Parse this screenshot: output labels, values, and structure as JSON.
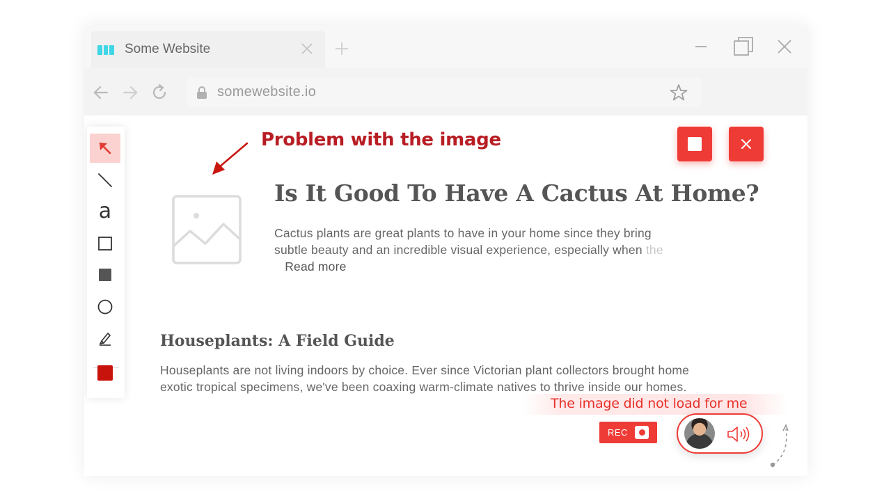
{
  "browser": {
    "tab_title": "Some Website",
    "url": "somewebsite.io"
  },
  "annotation": {
    "title": "Problem with the image",
    "comment": "The image did not load for me"
  },
  "article": {
    "title": "Is It Good To Have A Cactus At Home?",
    "body": "Cactus plants are great plants to have in your home since they bring subtle beauty and an incredible visual experience, especially when ",
    "body_faded": "the",
    "read_more": "Read more"
  },
  "guide": {
    "title": "Houseplants: A Field Guide",
    "body": "Houseplants are not living indoors by choice. Ever since Victorian plant collectors brought home exotic tropical specimens, we've been coaxing warm-climate natives to thrive inside our homes."
  },
  "recorder": {
    "rec_label": "REC"
  },
  "colors": {
    "accent_red": "#ef3b36",
    "annotation_red": "#b81d24",
    "selected_color": "#c8120c",
    "favicon": "#3fd6e6",
    "tool_active_bg": "#fbd2cf"
  },
  "icons": {
    "tools": [
      "arrow-select-icon",
      "line-icon",
      "text-icon",
      "rectangle-icon",
      "filled-rectangle-icon",
      "circle-icon",
      "marker-icon",
      "color-swatch-icon"
    ]
  }
}
